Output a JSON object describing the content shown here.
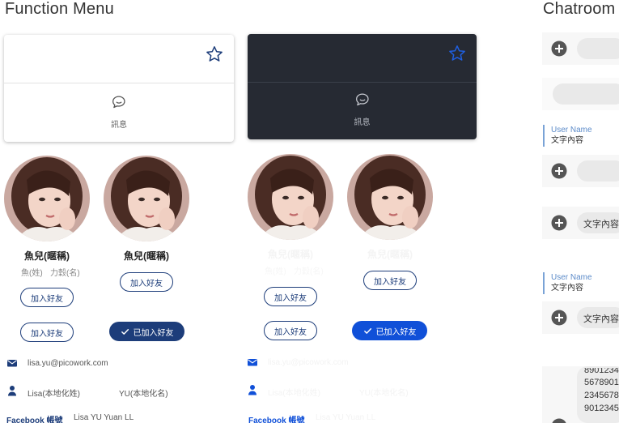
{
  "sections": {
    "function_menu_title": "Function Menu",
    "chatroom_title": "Chatroom"
  },
  "cards": {
    "message_label_light": "訊息",
    "message_label_dark": "訊息"
  },
  "profiles": {
    "nickname_a": "魚兒(暱稱)",
    "nickname_b": "魚兒(暱稱)",
    "nickname_c": "魚兒(暱稱)",
    "nickname_d": "魚兒(暱稱)",
    "surname": "魚(姓)",
    "given_name": "力穀(名)",
    "surname_ghost": "魚(姓)",
    "given_name_ghost": "力穀(名)"
  },
  "buttons": {
    "add_friend": "加入好友",
    "added_friend": "已加入好友"
  },
  "contact": {
    "email": "lisa.yu@picowork.com",
    "localized_surname": "Lisa(本地化姓)",
    "localized_given": "YU(本地化名)",
    "facebook_label": "Facebook 帳號",
    "facebook_value": "Lisa YU Yuan LL",
    "email_ghost": "lisa.yu@picowork.com",
    "localized_surname_ghost": "Lisa(本地化姓)",
    "localized_given_ghost": "YU(本地化名)",
    "facebook_label_ghost": "Facebook 帳號",
    "facebook_value_ghost": "Lisa YU Yuan LL"
  },
  "chat": {
    "quote_user_1": "User Name",
    "quote_text_1": "文字內容",
    "quote_user_2": "User Name",
    "quote_text_2": "文字內容",
    "bubble_text_1": "文字內容",
    "bubble_text_2": "文字內容",
    "number_lines": [
      "8901234",
      "5678901",
      "2345678",
      "9012345"
    ]
  },
  "colors": {
    "navy": "#1d3d7a",
    "bright_blue": "#1050d8",
    "dark_card": "#262a33"
  }
}
